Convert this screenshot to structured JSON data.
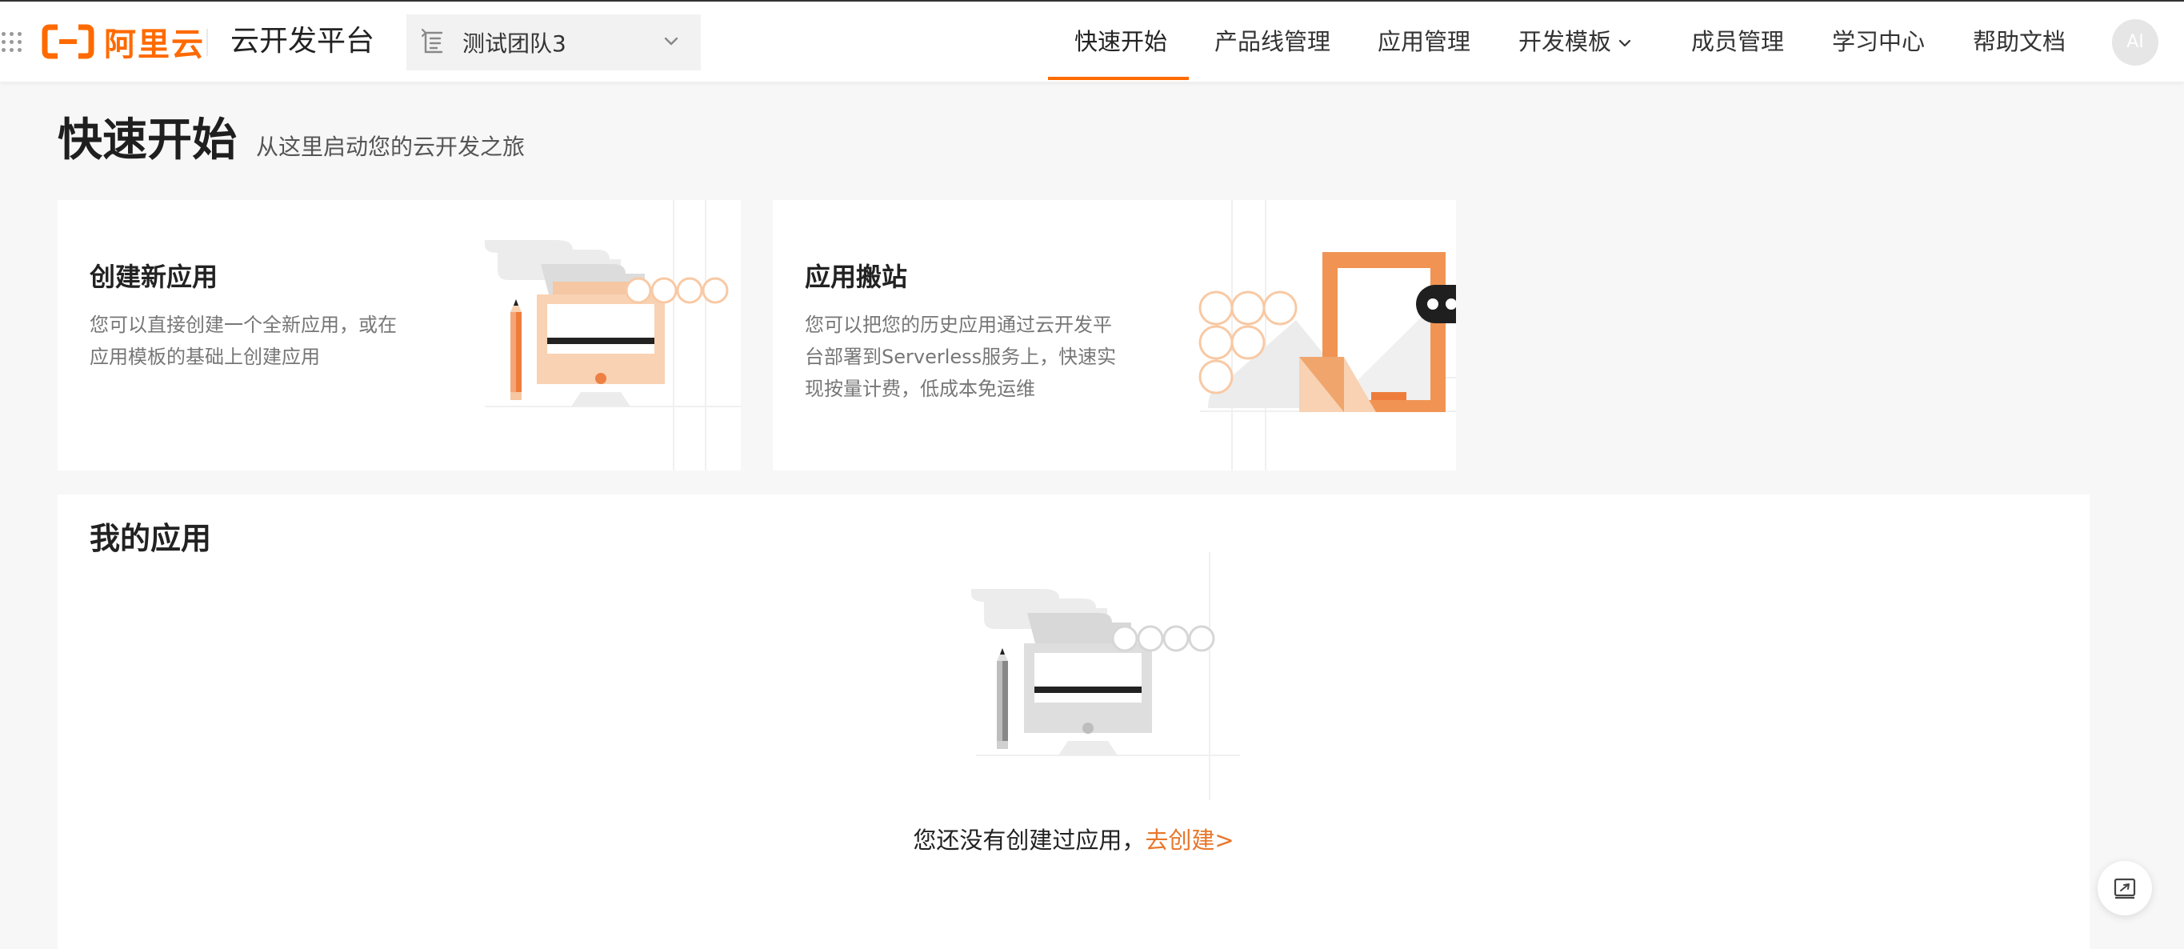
{
  "header": {
    "logo_text": "阿里云",
    "platform_title": "云开发平台",
    "team_selector": {
      "value": "测试团队3"
    },
    "nav": [
      {
        "label": "快速开始",
        "active": true
      },
      {
        "label": "产品线管理"
      },
      {
        "label": "应用管理"
      },
      {
        "label": "开发模板",
        "has_dropdown": true
      },
      {
        "label": "成员管理"
      },
      {
        "label": "学习中心"
      },
      {
        "label": "帮助文档"
      }
    ],
    "avatar_text": "AI"
  },
  "page": {
    "title": "快速开始",
    "subtitle": "从这里启动您的云开发之旅"
  },
  "cards": [
    {
      "title": "创建新应用",
      "description": "您可以直接创建一个全新应用，或在应用模板的基础上创建应用"
    },
    {
      "title": "应用搬站",
      "description": "您可以把您的历史应用通过云开发平台部署到Serverless服务上，快速实现按量计费，低成本免运维"
    }
  ],
  "my_apps": {
    "title": "我的应用",
    "empty_text": "您还没有创建过应用，",
    "create_link": "去创建>"
  },
  "colors": {
    "brand": "#ff6a00",
    "accent_link": "#e8762b",
    "illustration_orange": "#f8c9a4"
  },
  "icons": [
    "apps-grid-icon",
    "team-icon",
    "chevron-down-icon",
    "feedback-icon"
  ]
}
